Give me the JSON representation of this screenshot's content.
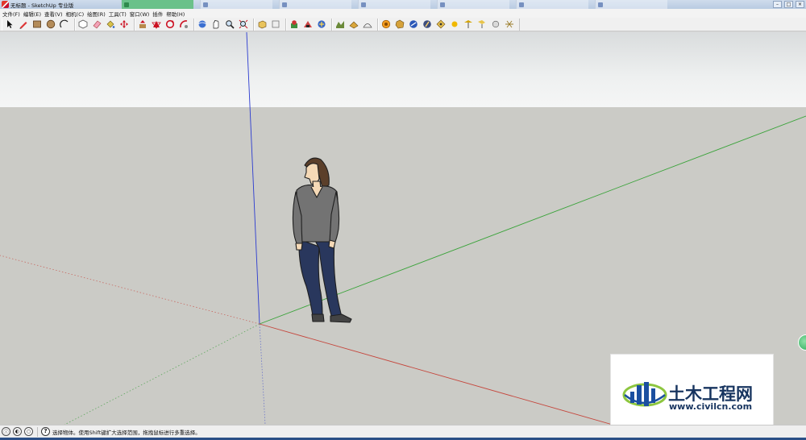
{
  "window": {
    "title": "无标题 - SketchUp 专业版",
    "controls": [
      "–",
      "□",
      "×"
    ]
  },
  "menu": [
    "文件(F)",
    "编辑(E)",
    "查看(V)",
    "相机(C)",
    "绘图(R)",
    "工具(T)",
    "窗口(W)",
    "插件",
    "帮助(H)"
  ],
  "toolbar": {
    "groups": [
      [
        "select-arrow",
        "pencil-line",
        "rectangle",
        "circle",
        "arc"
      ],
      [
        "make-component",
        "eraser",
        "paint-bucket",
        "move"
      ],
      [
        "push-pull",
        "rotate",
        "follow-me",
        "scale"
      ],
      [
        "orbit",
        "pan",
        "zoom",
        "zoom-extents"
      ],
      [
        "iso-view",
        "top-view"
      ],
      [
        "add-location",
        "get-models",
        "share-model"
      ],
      [
        "sandbox-1",
        "sandbox-2",
        "sandbox-3"
      ],
      [
        "shadow",
        "fog",
        "section",
        "walk",
        "look-around",
        "position-camera",
        "sun",
        "dimension",
        "text",
        "axes"
      ]
    ]
  },
  "viewport": {
    "sky_color": "#eceeee",
    "ground_color": "#cbcbc6",
    "axis_colors": {
      "red": "#c5463c",
      "green": "#3aa33a",
      "blue": "#2b3bd0"
    },
    "model": "person-figure"
  },
  "watermark": {
    "name": "土木工程网",
    "url": "www.civilcn.com",
    "brand_color": "#17345f"
  },
  "statusbar": {
    "hint": "选择物体。使用Shift键扩大选择范围，拖拽鼠标进行多重选择。"
  }
}
